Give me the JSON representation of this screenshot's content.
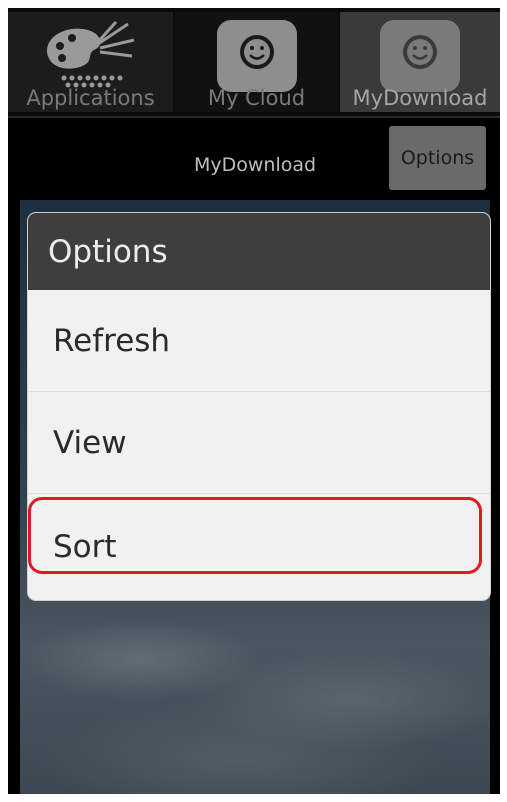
{
  "tabs": [
    {
      "label": "Applications",
      "icon": "palette-icon"
    },
    {
      "label": "My Cloud",
      "icon": "smiley-network-icon"
    },
    {
      "label": "MyDownload",
      "icon": "smiley-network-icon",
      "selected": true
    }
  ],
  "header": {
    "title": "MyDownload",
    "options_label": "Options"
  },
  "dialog": {
    "title": "Options",
    "items": [
      {
        "label": "Refresh"
      },
      {
        "label": "View"
      },
      {
        "label": "Sort",
        "highlighted": true
      }
    ]
  },
  "colors": {
    "highlight": "#e01a22",
    "dialog_header": "#3e3e3e",
    "dialog_body": "#f1f1f1"
  }
}
